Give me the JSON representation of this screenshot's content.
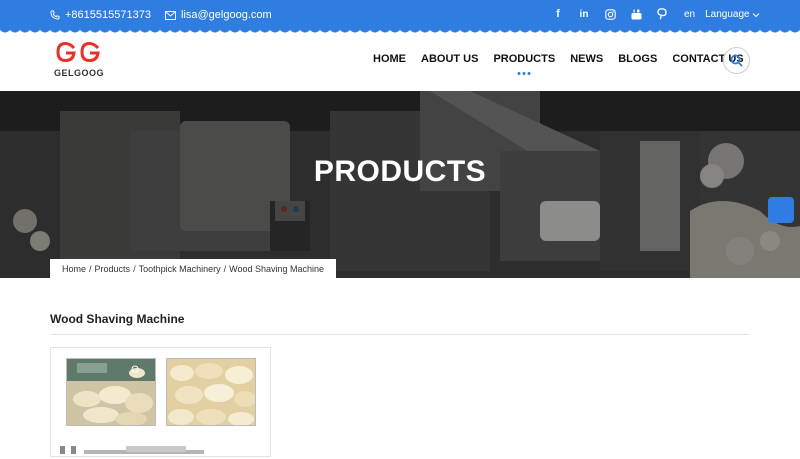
{
  "topbar": {
    "phone": "+8615515571373",
    "email": "lisa@gelgoog.com",
    "social_icons": [
      "facebook-icon",
      "linkedin-icon",
      "instagram-icon",
      "youtube-icon",
      "pinterest-icon"
    ],
    "lang_code": "en",
    "language_label": "Language"
  },
  "brand": {
    "name": "GELGOOG",
    "accent_color": "#2f7de1",
    "logo_color": "#e8302a"
  },
  "nav": {
    "items": [
      "HOME",
      "ABOUT US",
      "PRODUCTS",
      "NEWS",
      "BLOGS",
      "CONTACT US"
    ],
    "active": "PRODUCTS"
  },
  "hero": {
    "title": "PRODUCTS"
  },
  "breadcrumb": [
    "Home",
    "Products",
    "Toothpick Machinery",
    "Wood Shaving Machine"
  ],
  "page": {
    "title": "Wood Shaving Machine"
  }
}
